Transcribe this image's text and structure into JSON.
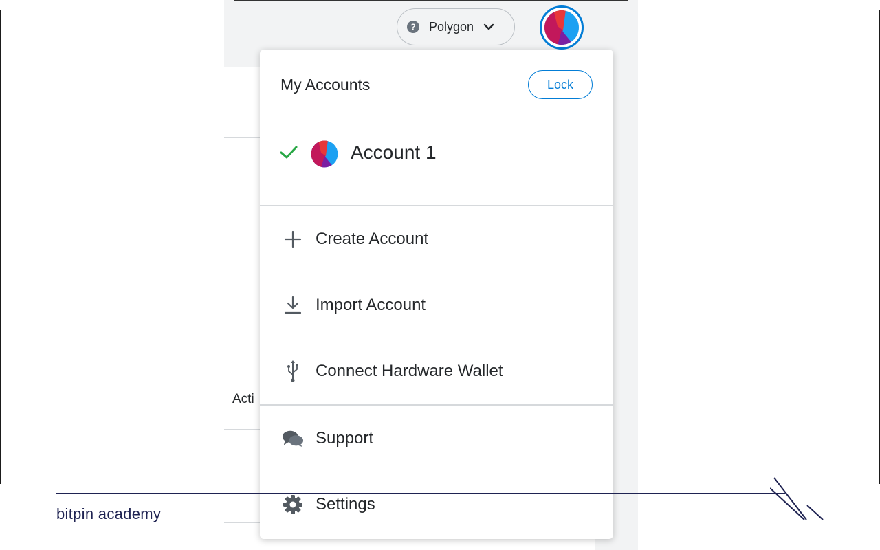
{
  "network": {
    "name": "Polygon",
    "status_icon": "question-icon"
  },
  "background": {
    "partial_label": "Acti"
  },
  "menu": {
    "title": "My Accounts",
    "lock_label": "Lock",
    "accounts": [
      {
        "name": "Account 1",
        "selected": true
      }
    ],
    "items": [
      {
        "label": "Create Account",
        "icon": "plus-icon"
      },
      {
        "label": "Import Account",
        "icon": "download-icon"
      },
      {
        "label": "Connect Hardware Wallet",
        "icon": "usb-icon"
      },
      {
        "label": "Support",
        "icon": "chat-bubbles-icon"
      },
      {
        "label": "Settings",
        "icon": "gear-icon"
      }
    ]
  },
  "branding": {
    "text": "bitpin academy"
  },
  "colors": {
    "accent": "#037dd6",
    "check": "#28a745",
    "brand": "#1f2352",
    "avatar_blue": "#1da1f2",
    "avatar_red": "#e8383a",
    "avatar_magenta": "#c2185b"
  }
}
